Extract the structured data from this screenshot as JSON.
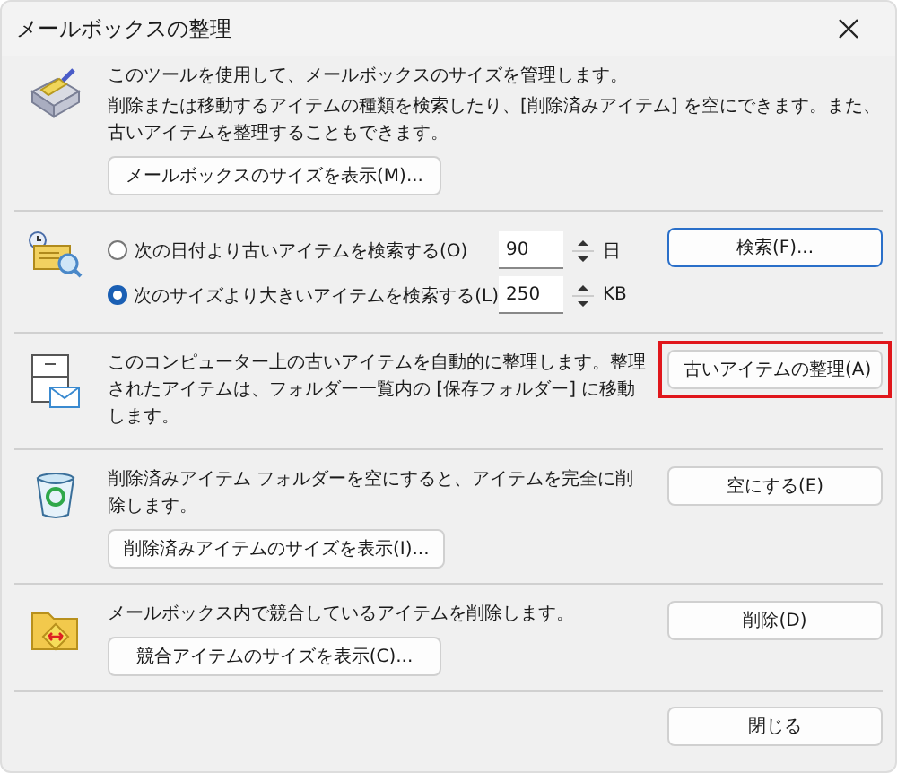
{
  "window": {
    "title": "メールボックスの整理"
  },
  "sections": [
    {
      "kind": "intro",
      "texts": [
        "このツールを使用して、メールボックスのサイズを管理します。",
        "削除または移動するアイテムの種類を検索したり、[削除済みアイテム] を空にできます。また、古いアイテムを整理することもできます。"
      ],
      "size_button": "メールボックスのサイズを表示(M)..."
    },
    {
      "kind": "search",
      "options": [
        {
          "label": "次の日付より古いアイテムを検索する(O)",
          "selected": false,
          "value": "90",
          "unit": "日"
        },
        {
          "label": "次のサイズより大きいアイテムを検索する(L)",
          "selected": true,
          "value": "250",
          "unit": "KB"
        }
      ],
      "button": {
        "label": "検索(F)...",
        "default": true,
        "highlighted": false
      }
    },
    {
      "kind": "archive",
      "texts": [
        "このコンピューター上の古いアイテムを自動的に整理します。整理されたアイテムは、フォルダー一覧内の [保存フォルダー] に移動します。"
      ],
      "button": {
        "label": "古いアイテムの整理(A)",
        "default": false,
        "highlighted": true
      }
    },
    {
      "kind": "trash",
      "texts": [
        "削除済みアイテム フォルダーを空にすると、アイテムを完全に削除します。"
      ],
      "size_button": "削除済みアイテムのサイズを表示(I)...",
      "button": {
        "label": "空にする(E)",
        "default": false,
        "highlighted": false
      }
    },
    {
      "kind": "conflict",
      "texts": [
        "メールボックス内で競合しているアイテムを削除します。"
      ],
      "size_button": "競合アイテムのサイズを表示(C)...",
      "button": {
        "label": "削除(D)",
        "default": false,
        "highlighted": false
      }
    }
  ],
  "close_button": "閉じる"
}
